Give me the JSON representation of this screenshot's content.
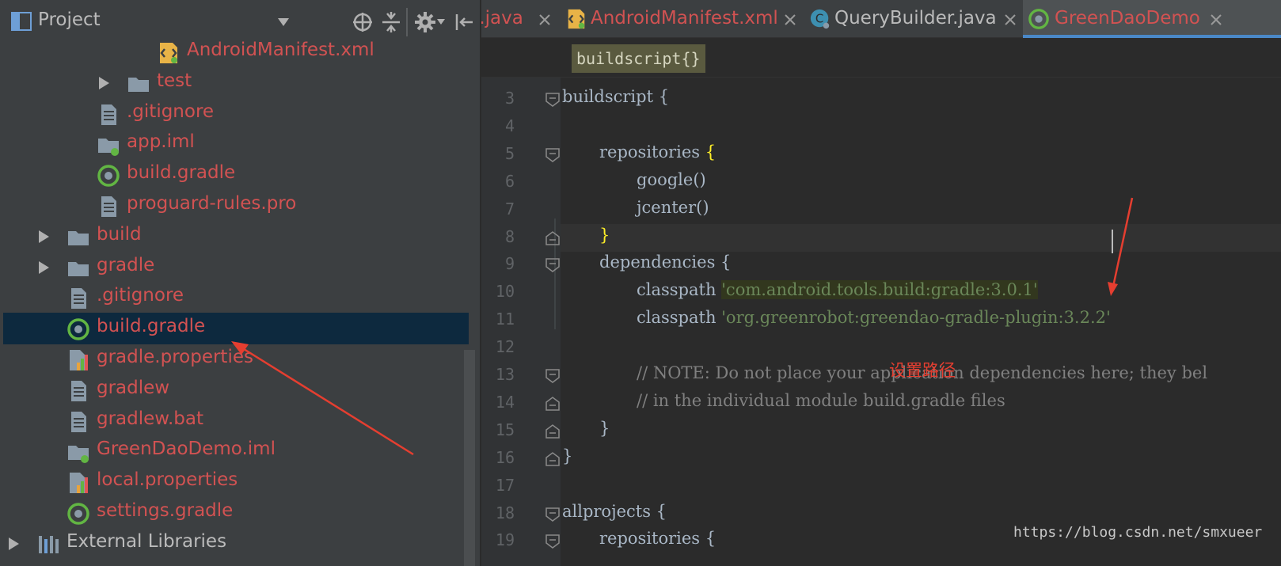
{
  "project_panel": {
    "title": "Project",
    "tree": [
      {
        "label": "AndroidManifest.xml",
        "icon": "android-manifest-icon",
        "depth": 5,
        "expandable": false,
        "color": "#d25252"
      },
      {
        "label": "test",
        "icon": "folder-icon",
        "depth": 4,
        "expandable": true,
        "color": "#d25252"
      },
      {
        "label": ".gitignore",
        "icon": "text-file-icon",
        "depth": 3,
        "expandable": false,
        "color": "#d25252"
      },
      {
        "label": "app.iml",
        "icon": "module-folder-icon",
        "depth": 3,
        "expandable": false,
        "color": "#d25252"
      },
      {
        "label": "build.gradle",
        "icon": "gradle-icon",
        "depth": 3,
        "expandable": false,
        "color": "#d25252"
      },
      {
        "label": "proguard-rules.pro",
        "icon": "text-file-icon",
        "depth": 3,
        "expandable": false,
        "color": "#d25252"
      },
      {
        "label": "build",
        "icon": "folder-icon",
        "depth": 2,
        "expandable": true,
        "color": "#d25252"
      },
      {
        "label": "gradle",
        "icon": "folder-icon",
        "depth": 2,
        "expandable": true,
        "color": "#d25252"
      },
      {
        "label": ".gitignore",
        "icon": "text-file-icon",
        "depth": 2,
        "expandable": false,
        "color": "#d25252"
      },
      {
        "label": "build.gradle",
        "icon": "gradle-icon",
        "depth": 2,
        "expandable": false,
        "color": "#d25252",
        "selected": true
      },
      {
        "label": "gradle.properties",
        "icon": "properties-file-icon",
        "depth": 2,
        "expandable": false,
        "color": "#d25252"
      },
      {
        "label": "gradlew",
        "icon": "text-file-icon",
        "depth": 2,
        "expandable": false,
        "color": "#d25252"
      },
      {
        "label": "gradlew.bat",
        "icon": "text-file-icon",
        "depth": 2,
        "expandable": false,
        "color": "#d25252"
      },
      {
        "label": "GreenDaoDemo.iml",
        "icon": "module-folder-icon",
        "depth": 2,
        "expandable": false,
        "color": "#d25252"
      },
      {
        "label": "local.properties",
        "icon": "properties-file-icon",
        "depth": 2,
        "expandable": false,
        "color": "#d25252"
      },
      {
        "label": "settings.gradle",
        "icon": "gradle-icon",
        "depth": 2,
        "expandable": false,
        "color": "#d25252"
      },
      {
        "label": "External Libraries",
        "icon": "libraries-icon",
        "depth": 1,
        "expandable": true,
        "color": "#bbbbbb"
      }
    ]
  },
  "tabs": [
    {
      "label": "ty.java",
      "icon": "",
      "active": false,
      "color": "#d25252"
    },
    {
      "label": "AndroidManifest.xml",
      "icon": "android-manifest-icon",
      "active": false,
      "color": "#d25252"
    },
    {
      "label": "QueryBuilder.java",
      "icon": "class-icon",
      "active": false,
      "color": "#bbbbbb"
    },
    {
      "label": "GreenDaoDemo",
      "icon": "gradle-icon",
      "active": true,
      "color": "#d25252"
    }
  ],
  "breadcrumb": "buildscript{}",
  "code_lines": [
    {
      "n": "3",
      "text": "buildscript {",
      "indent": 0
    },
    {
      "n": "4",
      "text": "",
      "indent": 0
    },
    {
      "n": "5",
      "text": "repositories {",
      "indent": 1
    },
    {
      "n": "6",
      "text": "google()",
      "indent": 2
    },
    {
      "n": "7",
      "text": "jcenter()",
      "indent": 2
    },
    {
      "n": "8",
      "text": "}",
      "indent": 1
    },
    {
      "n": "9",
      "text": "dependencies {",
      "indent": 1
    },
    {
      "n": "10",
      "text": "classpath ",
      "indent": 2,
      "string": "'com.android.tools.build:gradle:3.0.1'"
    },
    {
      "n": "11",
      "text": "classpath ",
      "indent": 2,
      "string": "'org.greenrobot:greendao-gradle-plugin:3.2.2'"
    },
    {
      "n": "12",
      "text": "",
      "indent": 0
    },
    {
      "n": "13",
      "text": "// NOTE: Do not place your application dependencies here; they bel",
      "indent": 2,
      "comment": true
    },
    {
      "n": "14",
      "text": "// in the individual module build.gradle files",
      "indent": 2,
      "comment": true
    },
    {
      "n": "15",
      "text": "}",
      "indent": 1
    },
    {
      "n": "16",
      "text": "}",
      "indent": 0
    },
    {
      "n": "17",
      "text": "",
      "indent": 0
    },
    {
      "n": "18",
      "text": "allprojects {",
      "indent": 0
    },
    {
      "n": "19",
      "text": "repositories {",
      "indent": 1
    }
  ],
  "annotation": "设置路径",
  "watermark": "https://blog.csdn.net/smxueer",
  "colors": {
    "vcs_modified": "#d25252",
    "string": "#6a8759",
    "comment": "#808080",
    "annotation_arrow": "#e53e30",
    "selection": "#0d293e"
  }
}
